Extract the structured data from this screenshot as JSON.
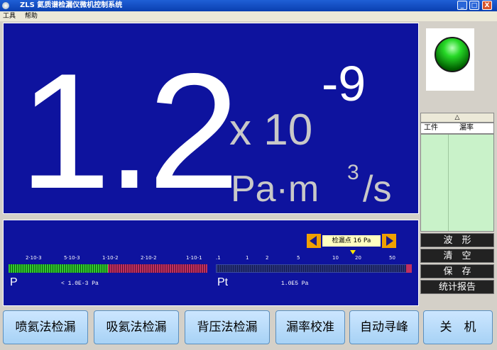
{
  "window": {
    "title": "ZLS 氦质谱检漏仪微机控制系统",
    "buttons": [
      "_",
      "□",
      "X"
    ]
  },
  "menu": {
    "items": [
      "工具",
      "帮助"
    ]
  },
  "display": {
    "mantissa": "1.2",
    "times": "x 10",
    "exponent": "-9",
    "unit_main": "Pa·m",
    "unit_sup": "3",
    "unit_tail": "/s"
  },
  "scale": {
    "point_label": "检漏点 16 Pa",
    "ticks_left": [
      "2·10-3",
      "5·10-3",
      "1·10-2",
      "2·10-2",
      "1·10-1"
    ],
    "ticks_right": [
      ".1",
      "1",
      "2",
      "5",
      "10",
      "20",
      "50"
    ],
    "left_unit": "P",
    "left_range": "< 1.0E-3  Pa",
    "right_unit": "Pt",
    "right_range": "1.0E5 Pa"
  },
  "sidebar": {
    "list_arrow": "△",
    "col_part": "工件",
    "col_rate": "漏率",
    "buttons": [
      "波　形",
      "清　空",
      "保　存",
      "统计报告"
    ]
  },
  "bottom_buttons": [
    "喷氦法检漏",
    "吸氦法检漏",
    "背压法检漏",
    "漏率校准",
    "自动寻峰",
    "关　机"
  ],
  "colors": {
    "panel_blue": "#0e139e",
    "lamp_green": "#27d927",
    "button_blue": "#a7d2f5",
    "arrow_orange": "#f0a000"
  }
}
